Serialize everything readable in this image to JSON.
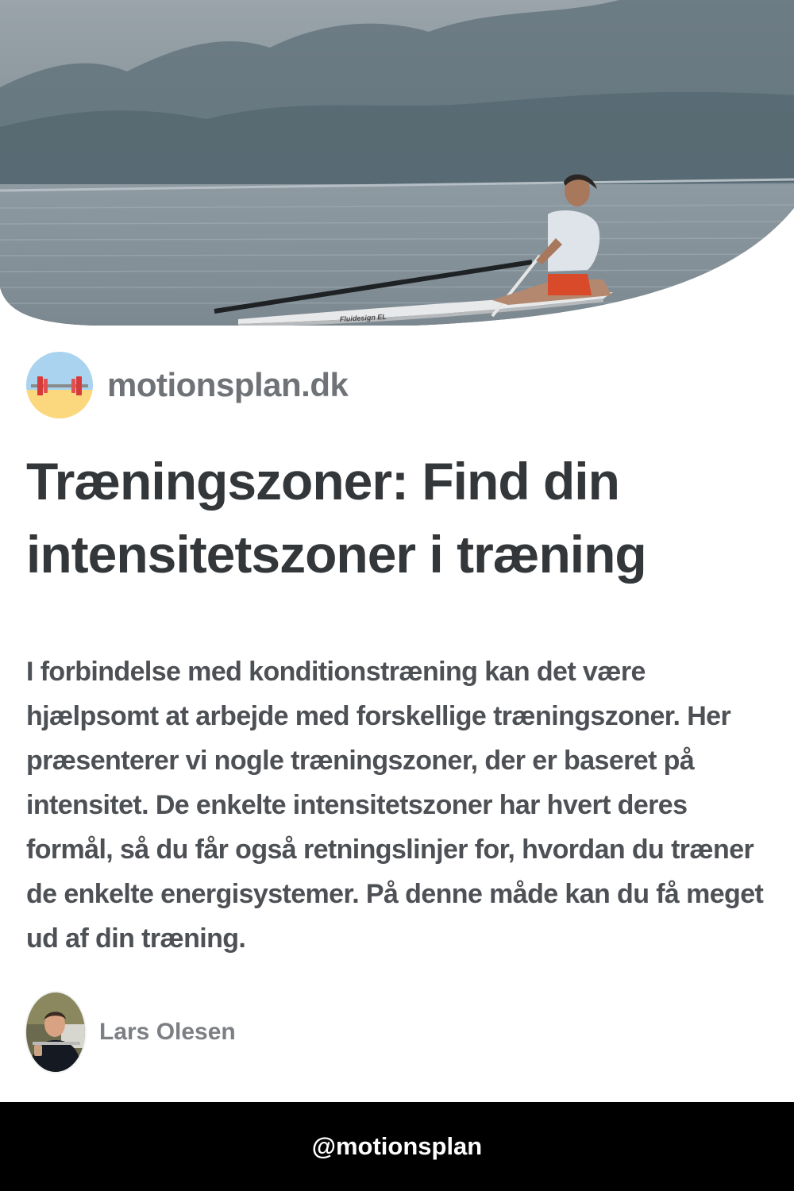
{
  "hero": {
    "image": "rower-on-misty-lake",
    "boat_label": "Fluidesign EL"
  },
  "brand": {
    "logo_icon": "barbell-beach-icon",
    "name": "motionsplan.dk"
  },
  "article": {
    "title": "Træningszoner: Find din intensitetszoner i træning",
    "description": "I forbindelse med konditionstræning kan det være hjælpsomt at arbejde med forskellige træningszoner. Her præsenterer vi nogle træningszoner, der er baseret på intensitet. De enkelte intensitetszoner har hvert deres formål, så du får også retningslinjer for, hvordan du træner de enkelte energisystemer. På denne måde kan du få meget ud af din træning."
  },
  "author": {
    "avatar": "author-photo",
    "name": "Lars Olesen"
  },
  "footer": {
    "handle": "@motionsplan"
  },
  "colors": {
    "footer_bg": "#000000",
    "title": "#34373a",
    "text": "#4d5054",
    "brand_name": "#6f7276"
  }
}
